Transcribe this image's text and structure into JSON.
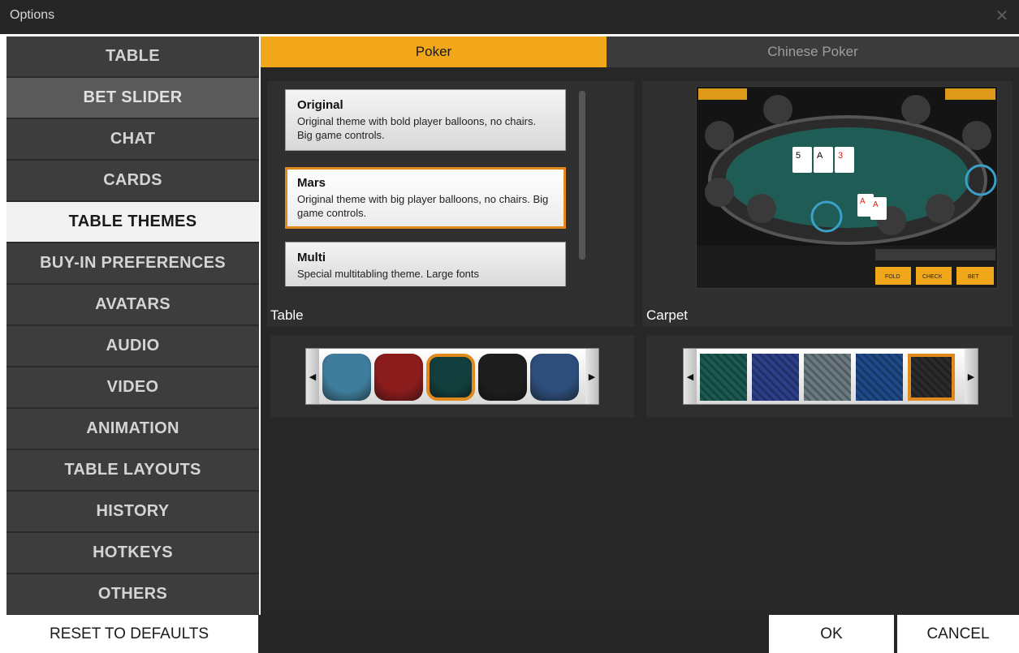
{
  "window": {
    "title": "Options",
    "close_icon": "close-icon"
  },
  "sidebar": {
    "items": [
      {
        "label": "TABLE"
      },
      {
        "label": "BET SLIDER"
      },
      {
        "label": "CHAT"
      },
      {
        "label": "CARDS"
      },
      {
        "label": "TABLE THEMES"
      },
      {
        "label": "BUY-IN PREFERENCES"
      },
      {
        "label": "AVATARS"
      },
      {
        "label": "AUDIO"
      },
      {
        "label": "VIDEO"
      },
      {
        "label": "ANIMATION"
      },
      {
        "label": "TABLE LAYOUTS"
      },
      {
        "label": "HISTORY"
      },
      {
        "label": "HOTKEYS"
      },
      {
        "label": "OTHERS"
      }
    ],
    "active": "TABLE THEMES"
  },
  "tabs": [
    {
      "label": "Poker",
      "active": true
    },
    {
      "label": "Chinese Poker",
      "active": false
    }
  ],
  "themes": [
    {
      "name": "Original",
      "description": "Original theme with bold player balloons, no chairs. Big game controls."
    },
    {
      "name": "Mars",
      "description": "Original theme with big player balloons, no chairs. Big game controls.",
      "selected": true
    },
    {
      "name": "Multi",
      "description": "Special multitabling theme. Large fonts"
    }
  ],
  "preview": {
    "buttons": [
      "FOLD",
      "CHECK",
      "BET"
    ],
    "cards_board": [
      "5",
      "A",
      "3"
    ],
    "cards_hand": [
      "A",
      "A"
    ]
  },
  "table_label": "Table",
  "carpet_label": "Carpet",
  "table_colors": [
    "#3f7d9c",
    "#8a1c1c",
    "#123f3d",
    "#1d1d1d",
    "#2d4d7a"
  ],
  "table_selected_index": 2,
  "carpet_colors": [
    "#1a5a52",
    "#2d3f8a",
    "#6b7a80",
    "#1f4a8a",
    "#2b2b2b"
  ],
  "carpet_selected_index": 4,
  "footer": {
    "reset_label": "RESET TO DEFAULTS",
    "ok_label": "OK",
    "cancel_label": "CANCEL"
  },
  "colors": {
    "accent": "#f2a71b",
    "selection": "#e08a1e"
  }
}
